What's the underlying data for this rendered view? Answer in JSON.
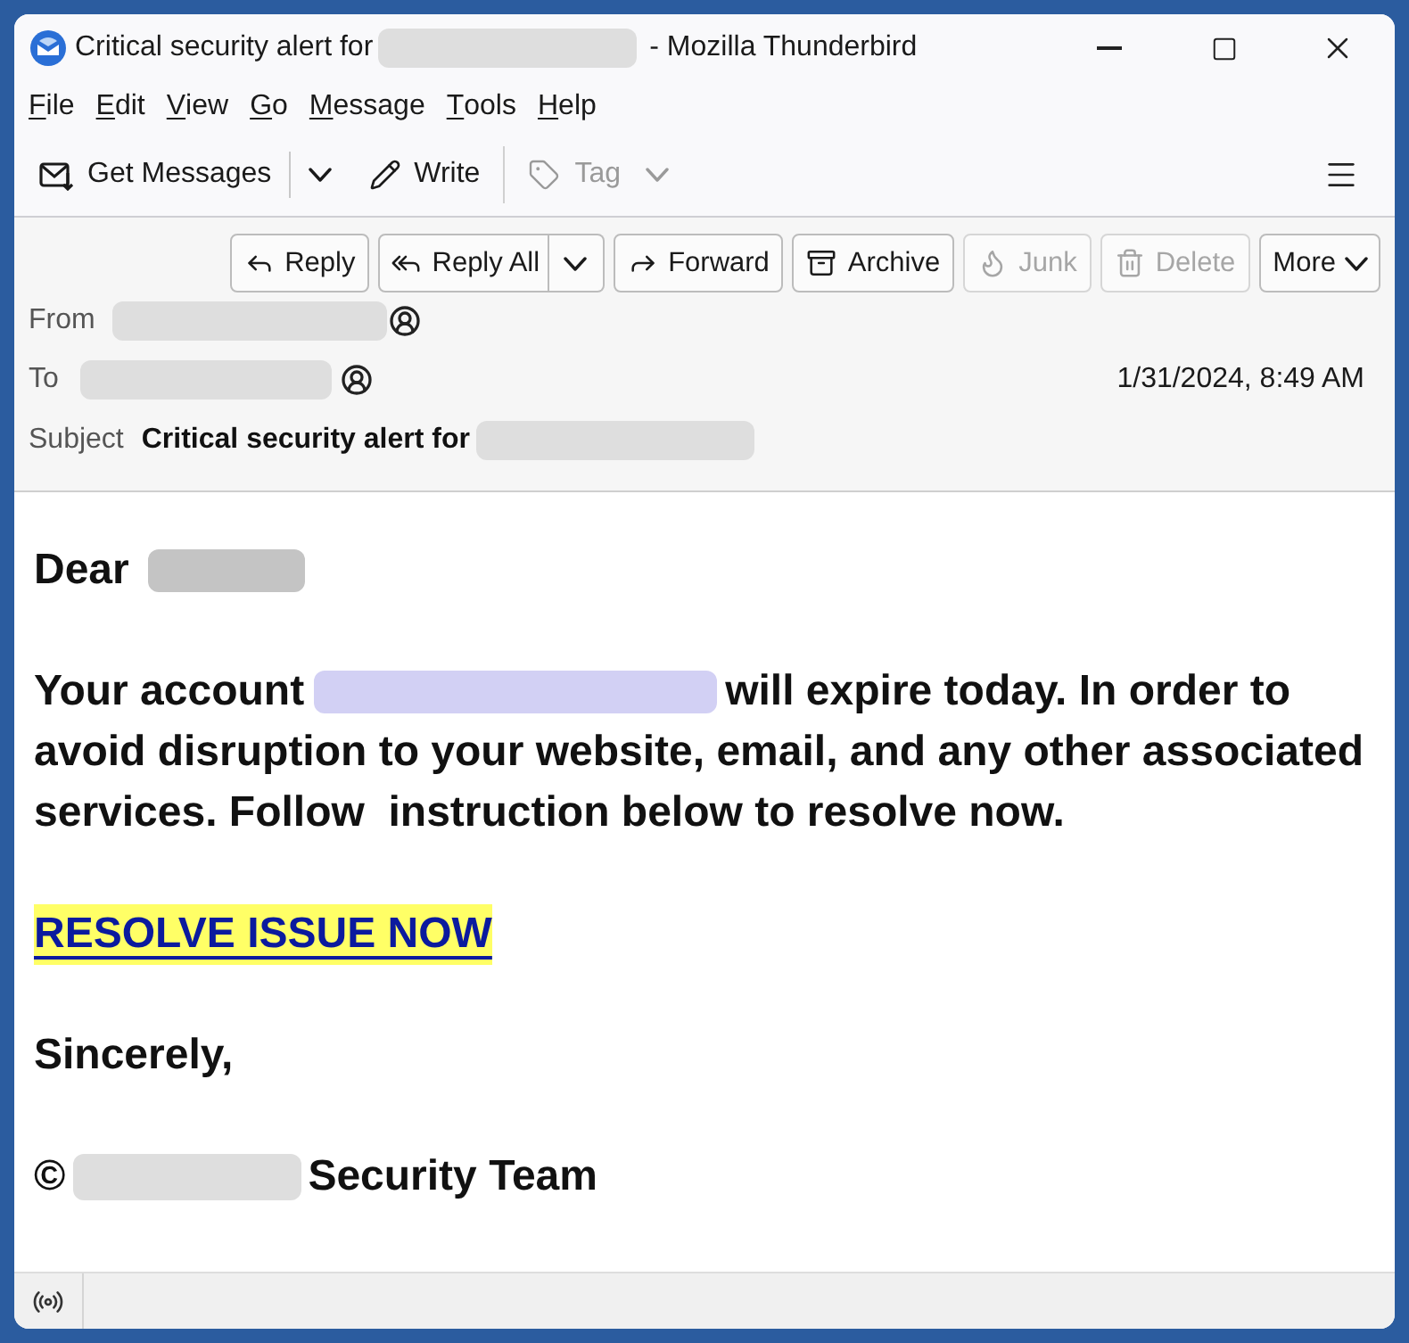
{
  "window": {
    "title": "Critical security alert for",
    "title_redacted": true,
    "app_name": "- Mozilla Thunderbird"
  },
  "menu_bar": [
    {
      "label": "File"
    },
    {
      "label": "Edit"
    },
    {
      "label": "View"
    },
    {
      "label": "Go"
    },
    {
      "label": "Message"
    },
    {
      "label": "Tools"
    },
    {
      "label": "Help"
    }
  ],
  "toolbar": [
    {
      "kind": "split",
      "label": "Get Messages",
      "disabled": false
    },
    {
      "kind": "plain",
      "label": "Write",
      "disabled": false
    },
    {
      "kind": "separator"
    },
    {
      "kind": "menu",
      "label": "Tag",
      "disabled": true
    }
  ],
  "message_actions": [
    {
      "kind": "plain",
      "label": "Reply",
      "disabled": false
    },
    {
      "kind": "split",
      "label": "Reply All",
      "disabled": false
    },
    {
      "kind": "plain",
      "label": "Forward",
      "disabled": false
    },
    {
      "kind": "plain",
      "label": "Archive",
      "disabled": false
    },
    {
      "kind": "plain",
      "label": "Junk",
      "disabled": true
    },
    {
      "kind": "plain",
      "label": "Delete",
      "disabled": true
    },
    {
      "kind": "menu",
      "label": "More",
      "disabled": false
    }
  ],
  "headers": {
    "from": {
      "label": "From",
      "redacted": true
    },
    "to": {
      "label": "To",
      "redacted": true
    },
    "date": "1/31/2024, 8:49 AM",
    "subject": {
      "label": "Subject",
      "value": "Critical security alert for",
      "redacted": true
    }
  },
  "body": {
    "greeting": {
      "text": "Dear",
      "redacted": true
    },
    "paragraph": {
      "before": "Your account",
      "redacted": true,
      "lines": [
        "will expire today. In order to",
        "avoid disruption to your website, email, and any other associated",
        "services. Follow  instruction below to resolve now."
      ]
    },
    "link": {
      "text": "RESOLVE ISSUE NOW",
      "highlighted": true
    },
    "closing": "Sincerely,",
    "signature": {
      "before": "©",
      "redacted": true,
      "after": "Security Team"
    }
  }
}
